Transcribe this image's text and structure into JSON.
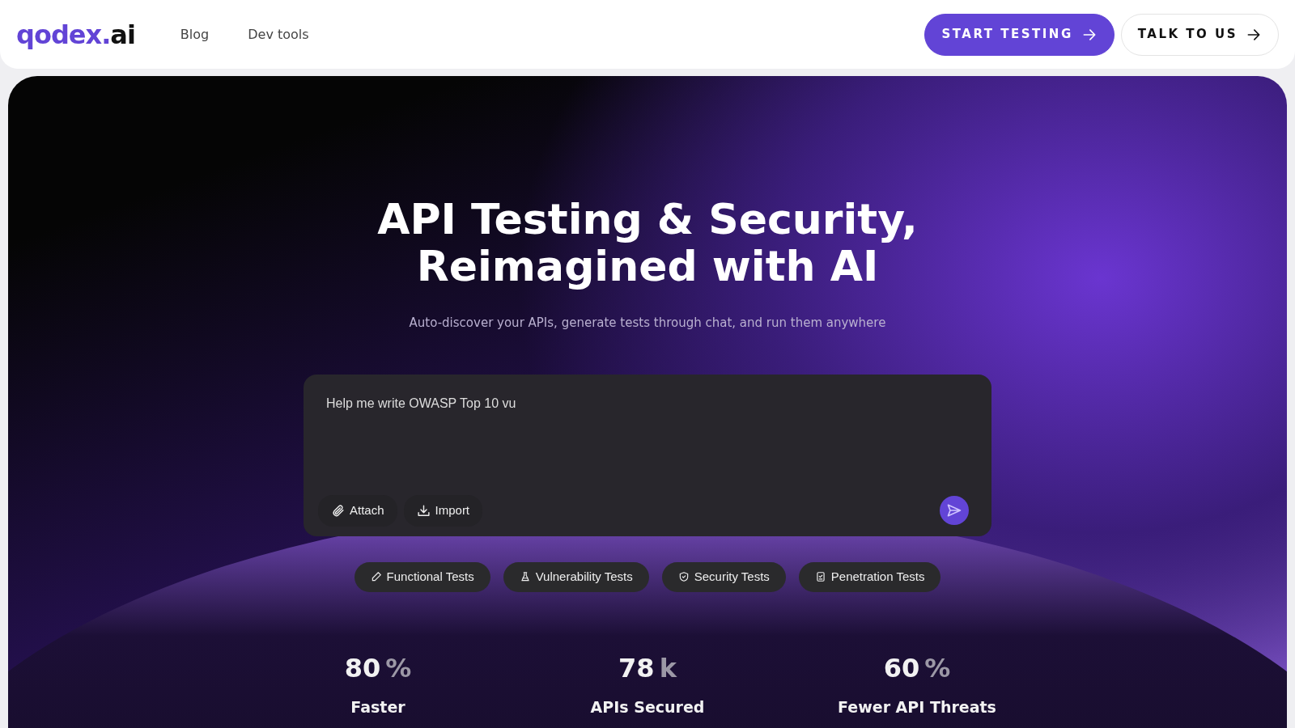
{
  "navbar": {
    "logo": {
      "main": "qodex.",
      "suffix": "ai"
    },
    "links": [
      {
        "label": "Blog"
      },
      {
        "label": "Dev tools"
      }
    ],
    "buttons": [
      {
        "label": "START TESTING",
        "kind": "primary"
      },
      {
        "label": "TALK TO US",
        "kind": "outline"
      }
    ]
  },
  "hero": {
    "title_lines": [
      "API Testing & Security,",
      "Reimagined with AI"
    ],
    "subtitle": "Auto-discover your APIs, generate tests through chat, and run them anywhere",
    "prompt": {
      "value": "Help me write OWASP Top 10 vu",
      "actions": [
        {
          "label": "Attach",
          "kind": "attach"
        },
        {
          "label": "Import",
          "kind": "import"
        }
      ]
    },
    "chips": [
      {
        "label": "Functional Tests",
        "kind": "pencil"
      },
      {
        "label": "Vulnerability Tests",
        "kind": "flask"
      },
      {
        "label": "Security Tests",
        "kind": "shield"
      },
      {
        "label": "Penetration Tests",
        "kind": "clipboard"
      }
    ],
    "stats": [
      {
        "value": "80",
        "unit": "%",
        "label": "Faster"
      },
      {
        "value": "78",
        "unit": "k",
        "label": "APIs Secured"
      },
      {
        "value": "60",
        "unit": "%",
        "label": "Fewer API Threats"
      }
    ]
  }
}
